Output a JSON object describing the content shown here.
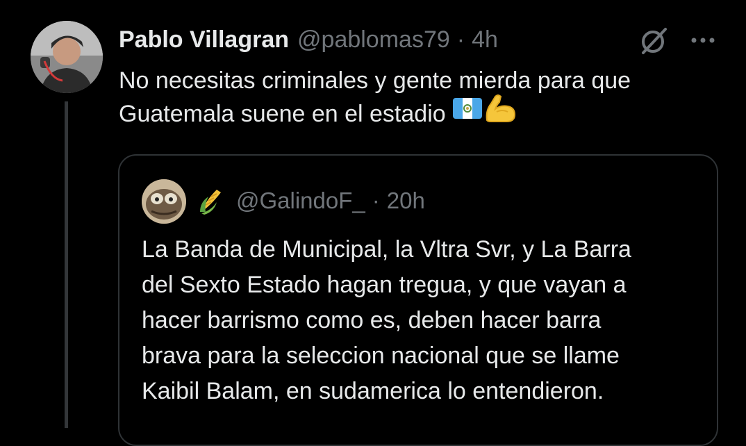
{
  "tweet": {
    "display_name": "Pablo Villagran",
    "handle": "@pablomas79",
    "separator": "·",
    "time": "4h",
    "text_lines": [
      "No necesitas criminales y gente mierda para que",
      "Guatemala suene en el estadio"
    ],
    "emojis": [
      "guatemala-flag-icon",
      "flexed-biceps-icon"
    ]
  },
  "quoted_tweet": {
    "display_name_emoji": "corn-icon",
    "handle": "@GalindoF_",
    "separator": "·",
    "time": "20h",
    "text_lines": [
      "La Banda de Municipal, la Vltra Svr, y La Barra",
      "del Sexto Estado hagan tregua, y que vayan a",
      "hacer barrismo como es, deben hacer barra",
      "brava para la seleccion nacional que se llame",
      "Kaibil Balam, en sudamerica lo entendieron."
    ]
  },
  "colors": {
    "background": "#000000",
    "primary_text": "#e7e9ea",
    "secondary_text": "#71767b",
    "border": "#2f3336"
  }
}
